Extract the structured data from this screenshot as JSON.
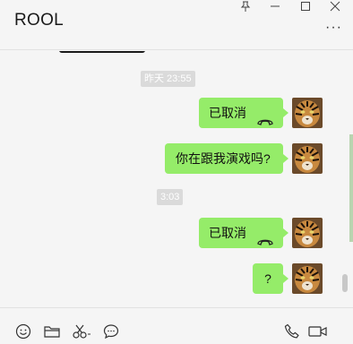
{
  "window": {
    "title": "ROOL",
    "controls": [
      "pin-icon",
      "minimize-icon",
      "maximize-icon",
      "close-icon"
    ],
    "more": "···"
  },
  "messages": [
    {
      "type": "time",
      "text": "昨天 23:55"
    },
    {
      "type": "call",
      "sender": "me",
      "text": "已取消"
    },
    {
      "type": "text",
      "sender": "me",
      "text": "你在跟我演戏吗?"
    },
    {
      "type": "time",
      "text": "3:03"
    },
    {
      "type": "call",
      "sender": "me",
      "text": "已取消"
    },
    {
      "type": "text",
      "sender": "me",
      "text": "?"
    }
  ],
  "toolbar": {
    "left": [
      "emoji-icon",
      "folder-icon",
      "scissors-icon",
      "chat-history-icon"
    ],
    "right": [
      "voice-call-icon",
      "video-call-icon"
    ]
  },
  "colors": {
    "background": "#f5f5f5",
    "bubble": "#95ec69",
    "time_badge": "#dadada"
  }
}
